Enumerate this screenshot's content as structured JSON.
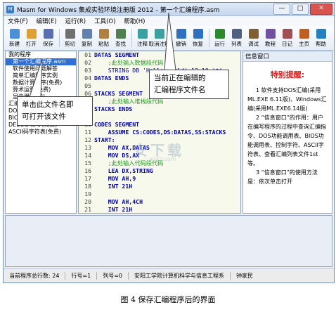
{
  "window": {
    "title": "Masm for Windows 集成实验环境注册版 2012 - 第一个汇编程序.asm",
    "buttons": {
      "minimize": "—",
      "maximize": "□",
      "close": "✕"
    }
  },
  "menu": [
    "文件(F)",
    "编辑(E)",
    "运行(R)",
    "工具(O)",
    "帮助(H)"
  ],
  "toolbar": [
    {
      "label": "新建",
      "icon": "new-file-icon",
      "color": "#4a90d9"
    },
    {
      "label": "打开",
      "icon": "open-folder-icon",
      "color": "#e0a030"
    },
    {
      "label": "保存",
      "icon": "save-disk-icon",
      "color": "#5a6fb0"
    },
    {
      "label": "剪切",
      "icon": "cut-icon",
      "color": "#707070"
    },
    {
      "label": "复制",
      "icon": "copy-icon",
      "color": "#6080b0"
    },
    {
      "label": "粘贴",
      "icon": "paste-icon",
      "color": "#b08040"
    },
    {
      "label": "查找",
      "icon": "find-icon",
      "color": "#508050"
    },
    {
      "label": "注释",
      "icon": "comment-icon",
      "color": "#3aa0a0"
    },
    {
      "label": "取消注释",
      "icon": "uncomment-icon",
      "color": "#3aa0a0"
    },
    {
      "label": "撤销",
      "icon": "undo-icon",
      "color": "#3070c0"
    },
    {
      "label": "恢复",
      "icon": "redo-icon",
      "color": "#3070c0"
    },
    {
      "label": "运行",
      "icon": "run-icon",
      "color": "#2a8a2a"
    },
    {
      "label": "列表",
      "icon": "list-icon",
      "color": "#506080"
    },
    {
      "label": "调试",
      "icon": "debug-icon",
      "color": "#806030"
    },
    {
      "label": "教程",
      "icon": "tutorial-icon",
      "color": "#7050a0"
    },
    {
      "label": "日记",
      "icon": "diary-icon",
      "color": "#a05050"
    },
    {
      "label": "主页",
      "icon": "home-icon",
      "color": "#c06020"
    },
    {
      "label": "帮助",
      "icon": "help-icon",
      "color": "#2080c0"
    }
  ],
  "tree": {
    "items": [
      {
        "text": "我的程序",
        "selected": false
      },
      {
        "text": "第一个汇编程序.asm",
        "selected": true
      },
      {
        "text": "软件使用问题解答",
        "selected": false
      },
      {
        "text": "简单汇编程序实例",
        "selected": false
      },
      {
        "text": "数据计算程序(免费)",
        "selected": false
      },
      {
        "text": "算术运算(免费)",
        "selected": false
      },
      {
        "text": "显示器(免费)",
        "selected": false
      },
      {
        "text": "汇编语言精讲信息表",
        "selected": false
      },
      {
        "text": "DOS 功能调用表(免费)",
        "selected": false
      },
      {
        "text": "BIOS 功能调用表(免费)",
        "selected": false
      },
      {
        "text": "DEBUG 命令(免费)",
        "selected": false
      },
      {
        "text": "ASCII码字符表(免费)",
        "selected": false
      }
    ]
  },
  "code": [
    {
      "n": "01",
      "parts": [
        {
          "t": "DATAS SEGMENT",
          "c": "kw"
        }
      ]
    },
    {
      "n": "02",
      "parts": [
        {
          "t": "    ;此处输入数据段代码",
          "c": "cm"
        }
      ]
    },
    {
      "n": "03",
      "parts": [
        {
          "t": "    STRING DB 'Hello World',13,10,'$'",
          "c": "st"
        }
      ]
    },
    {
      "n": "04",
      "parts": [
        {
          "t": "DATAS ENDS",
          "c": "kw"
        }
      ]
    },
    {
      "n": "05",
      "parts": [
        {
          "t": "",
          "c": ""
        }
      ]
    },
    {
      "n": "06",
      "parts": [
        {
          "t": "STACKS SEGMENT",
          "c": "kw"
        }
      ]
    },
    {
      "n": "07",
      "parts": [
        {
          "t": "    ;此处输入堆栈段代码",
          "c": "cm"
        }
      ]
    },
    {
      "n": "08",
      "parts": [
        {
          "t": "STACKS ENDS",
          "c": "kw"
        }
      ]
    },
    {
      "n": "09",
      "parts": [
        {
          "t": "",
          "c": ""
        }
      ]
    },
    {
      "n": "10",
      "parts": [
        {
          "t": "CODES SEGMENT",
          "c": "kw"
        }
      ]
    },
    {
      "n": "11",
      "parts": [
        {
          "t": "    ASSUME CS:CODES,DS:DATAS,SS:STACKS",
          "c": "kw"
        }
      ]
    },
    {
      "n": "12",
      "parts": [
        {
          "t": "START:",
          "c": "kw"
        }
      ]
    },
    {
      "n": "13",
      "parts": [
        {
          "t": "    MOV AX,DATAS",
          "c": "kw"
        }
      ]
    },
    {
      "n": "14",
      "parts": [
        {
          "t": "    MOV DS,AX",
          "c": "kw"
        }
      ]
    },
    {
      "n": "15",
      "parts": [
        {
          "t": "    ;此处输入代码段代码",
          "c": "cm"
        }
      ]
    },
    {
      "n": "16",
      "parts": [
        {
          "t": "    LEA DX,STRING",
          "c": "kw"
        }
      ]
    },
    {
      "n": "17",
      "parts": [
        {
          "t": "    MOV AH,9",
          "c": "kw"
        }
      ]
    },
    {
      "n": "18",
      "parts": [
        {
          "t": "    INT 21H",
          "c": "kw"
        }
      ]
    },
    {
      "n": "19",
      "parts": [
        {
          "t": "",
          "c": ""
        }
      ]
    },
    {
      "n": "20",
      "parts": [
        {
          "t": "    MOV AH,4CH",
          "c": "kw"
        }
      ]
    },
    {
      "n": "21",
      "parts": [
        {
          "t": "    INT 21H",
          "c": "kw"
        }
      ]
    }
  ],
  "info": {
    "title": "信息窗口",
    "heading": "特别提醒:",
    "paragraphs": [
      "1 软件支持DOS汇编(采用ML.EXE 6.11版)、Windows汇编(采用ML.EXE6.14版)",
      "2 “信息窗口”的作用：用户在编写程序的过程中查询汇编指令、DOS功能调用表、BIOS功能调用表、控制字符、ASCII字符表、查看汇编列表文件1st等。",
      "3 “信息窗口”的使用方法是：依次单击打开"
    ]
  },
  "status": {
    "total_lines": "当前程序总行数:  24",
    "row": "行号=1",
    "col": "列号=0",
    "org": "安阳工学院计算机科学与信息工程系",
    "author": "钟家民"
  },
  "callouts": {
    "left": "单击此文件名即\n可打开该文件",
    "right": "当前正在编辑的\n汇编程序文件名"
  },
  "watermark": {
    "main": "安下载",
    "sub": "anxz.com"
  },
  "caption": "图 4 保存汇编程序后的界面"
}
